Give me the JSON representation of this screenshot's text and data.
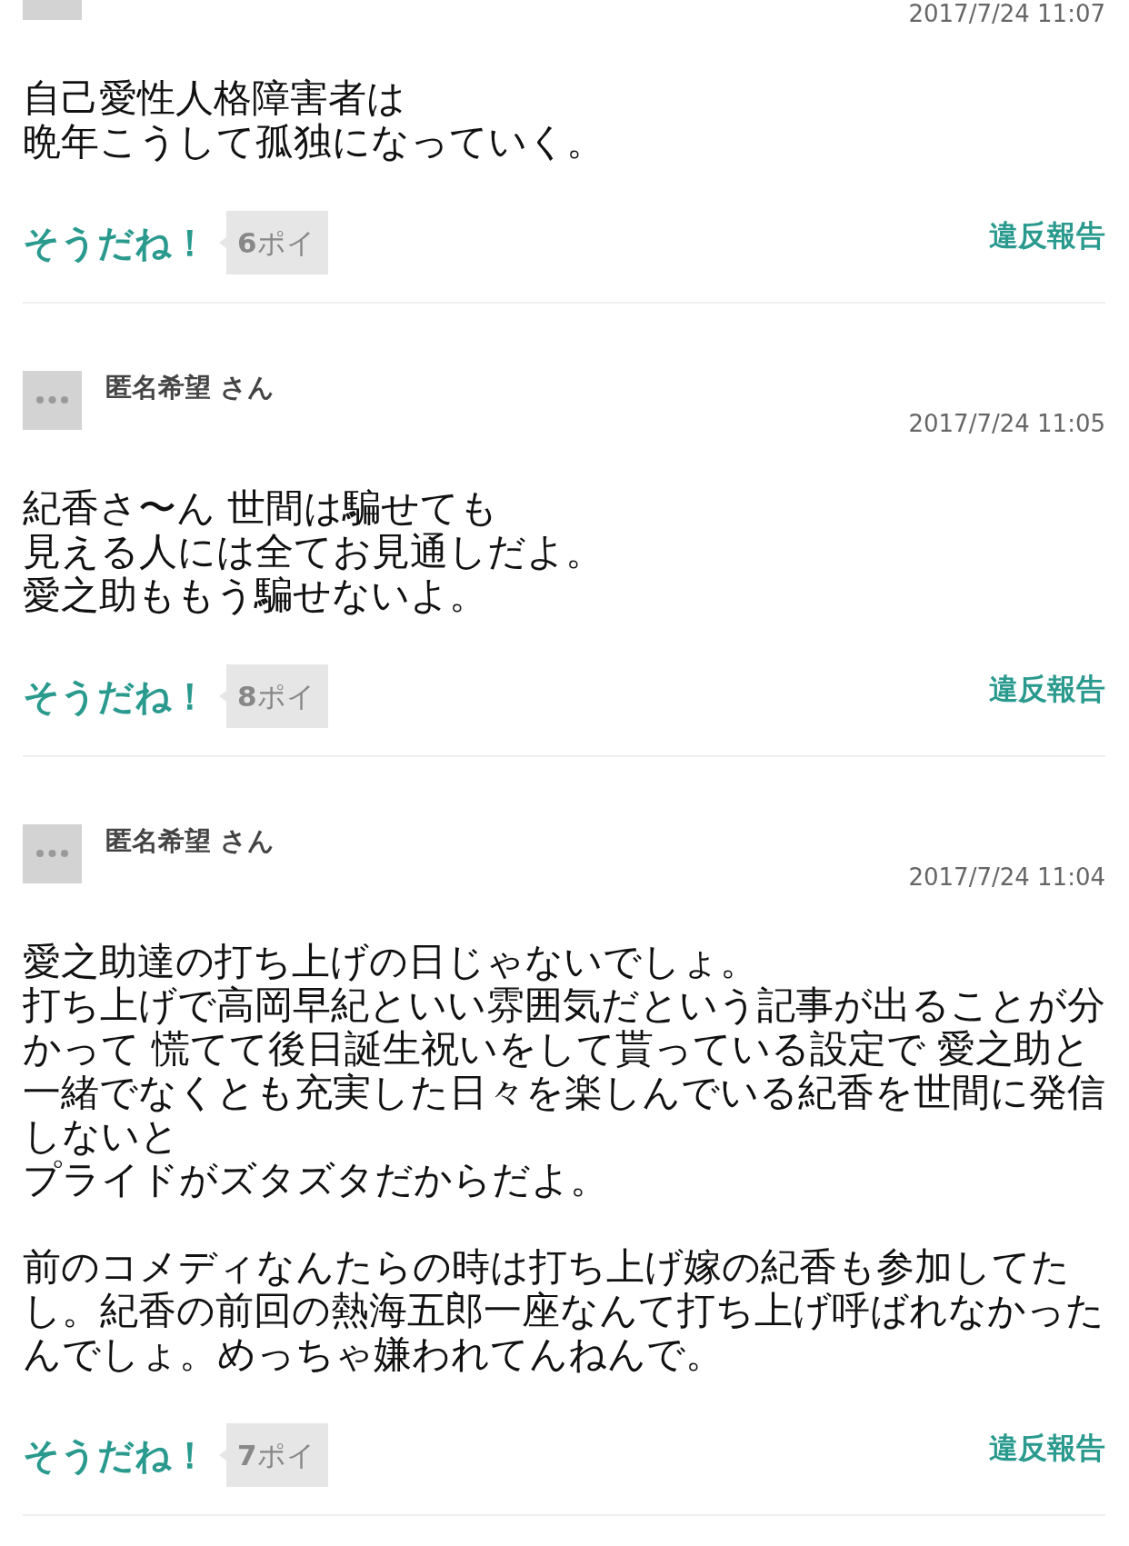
{
  "comments": [
    {
      "date": "2017/7/24 11:07",
      "paragraphs": [
        [
          "自己愛性人格障害者は",
          "晩年こうして孤独になっていく。"
        ]
      ],
      "agree": "そうだね！",
      "points": "**6**ポイ",
      "report": "違反報告"
    },
    {
      "name": "匿名希望 さん",
      "date": "2017/7/24 11:05",
      "paragraphs": [
        [
          "紀香さ〜ん 世間は騙せても",
          "見える人には全てお見通しだよ。",
          "愛之助ももう騙せないよ。"
        ]
      ],
      "agree": "そうだね！",
      "points": "**8**ポイ",
      "report": "違反報告"
    },
    {
      "name": "匿名希望 さん",
      "date": "2017/7/24 11:04",
      "paragraphs": [
        [
          "愛之助達の打ち上げの日じゃないでしょ。",
          "打ち上げで高岡早紀といい雰囲気だという記事が出ることが分かって 慌てて後日誕生祝いをして貰っている設定で 愛之助と一緒でなくとも充実した日々を楽しんでいる紀香を世間に発信",
          "しないと",
          "プライドがズタズタだからだよ。"
        ],
        [
          "前のコメディなんたらの時は打ち上げ嫁の紀香も参加してたし。紀香の前回の熱海五郎一座なんて打ち上げ呼ばれなかったんでしょ。めっちゃ嫌われてんねんで。"
        ]
      ],
      "agree": "そうだね！",
      "points": "**7**ポイ",
      "report": "違反報告"
    }
  ]
}
